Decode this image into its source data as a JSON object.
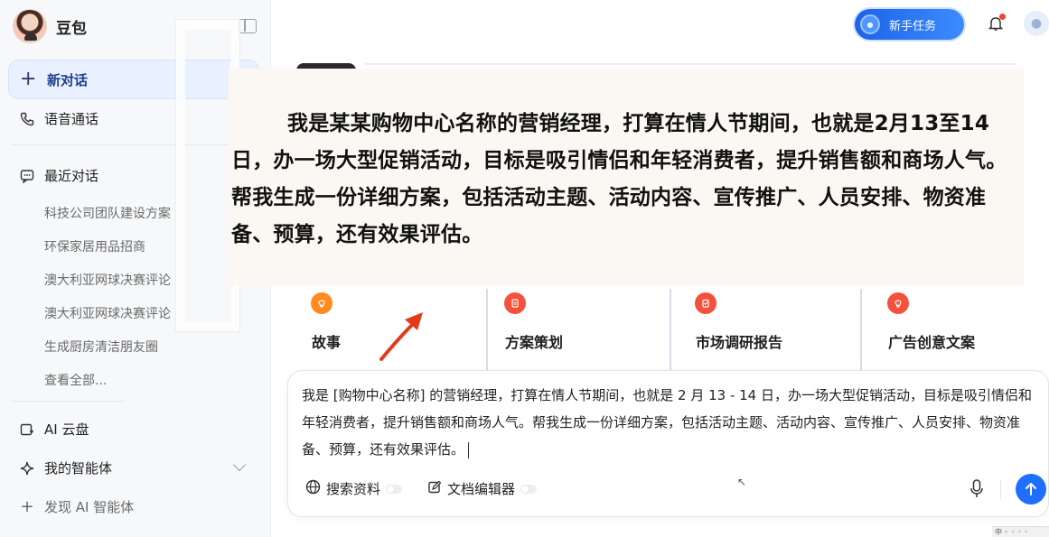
{
  "app": {
    "name": "豆包"
  },
  "sidebar": {
    "new_chat": "新对话",
    "voice_call": "语音通话",
    "recent_title": "最近对话",
    "recent": [
      "科技公司团队建设方案",
      "环保家居用品招商",
      "澳大利亚网球决赛评论",
      "澳大利亚网球决赛评论",
      "生成厨房清洁朋友圈",
      "查看全部..."
    ],
    "cloud": "AI 云盘",
    "agents": "我的智能体",
    "discover": "发现 AI 智能体"
  },
  "topbar": {
    "task_button": "新手任务"
  },
  "overlay": {
    "text": "我是某某购物中心名称的营销经理，打算在情人节期间，也就是2月13至14日，办一场大型促销活动，目标是吸引情侣和年轻消费者，提升销售额和商场人气。帮我生成一份详细方案，包括活动主题、活动内容、宣传推广、人员安排、物资准备、预算，还有效果评估。"
  },
  "cards": [
    {
      "title": "故事",
      "icon": "lightbulb-icon",
      "color": "#ff8a1f"
    },
    {
      "title": "方案策划",
      "icon": "document-icon",
      "color": "#f4513c"
    },
    {
      "title": "市场调研报告",
      "icon": "clipboard-icon",
      "color": "#f4513c"
    },
    {
      "title": "广告创意文案",
      "icon": "lightbulb-icon",
      "color": "#f4513c"
    }
  ],
  "input": {
    "value": "我是 [购物中心名称] 的营销经理，打算在情人节期间，也就是 2 月 13 - 14 日，办一场大型促销活动，目标是吸引情侣和年轻消费者，提升销售额和商场人气。帮我生成一份详细方案，包括活动主题、活动内容、宣传推广、人员安排、物资准备、预算，还有效果评估。"
  },
  "tools": {
    "search": "搜索资料",
    "editor": "文档编辑器"
  },
  "colors": {
    "accent": "#1f6fff",
    "arrow": "#e23b1a"
  }
}
